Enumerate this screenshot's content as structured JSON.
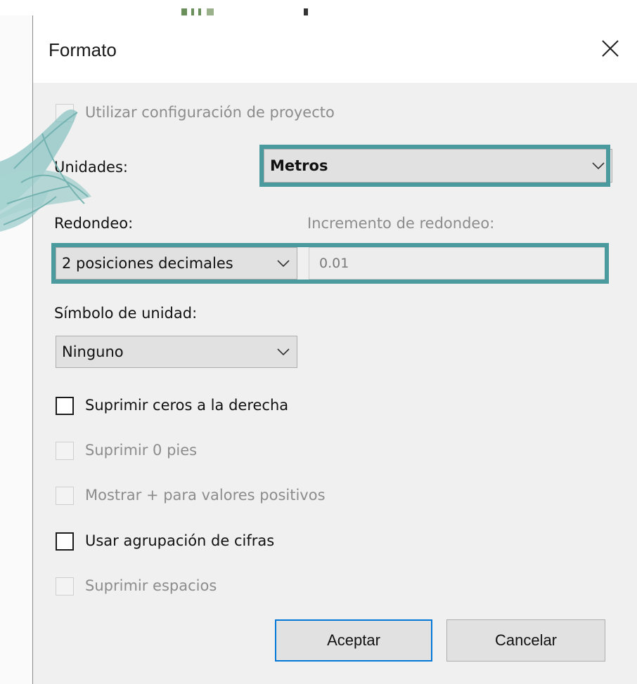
{
  "dialog": {
    "title": "Formato",
    "close_icon": "close-icon"
  },
  "options": {
    "use_project_settings": {
      "label": "Utilizar configuración de proyecto",
      "checked": false,
      "enabled": false
    },
    "units": {
      "label": "Unidades:",
      "value": "Metros"
    },
    "rounding": {
      "label": "Redondeo:",
      "value": "2 posiciones decimales"
    },
    "rounding_increment": {
      "label": "Incremento de redondeo:",
      "value": "0.01"
    },
    "unit_symbol": {
      "label": "Símbolo de unidad:",
      "value": "Ninguno"
    },
    "suppress_trailing_zeros": {
      "label": "Suprimir ceros a la derecha",
      "checked": false,
      "enabled": true
    },
    "suppress_0_feet": {
      "label": "Suprimir 0 pies",
      "checked": false,
      "enabled": false
    },
    "show_plus": {
      "label": "Mostrar + para valores positivos",
      "checked": false,
      "enabled": false
    },
    "digit_grouping": {
      "label": "Usar agrupación de cifras",
      "checked": false,
      "enabled": true
    },
    "suppress_spaces": {
      "label": "Suprimir espacios",
      "checked": false,
      "enabled": false
    }
  },
  "buttons": {
    "ok": "Aceptar",
    "cancel": "Cancelar"
  },
  "colors": {
    "highlight": "#4a9a9e",
    "default_button_border": "#0078d7",
    "dialog_background": "#f0f0f0"
  }
}
